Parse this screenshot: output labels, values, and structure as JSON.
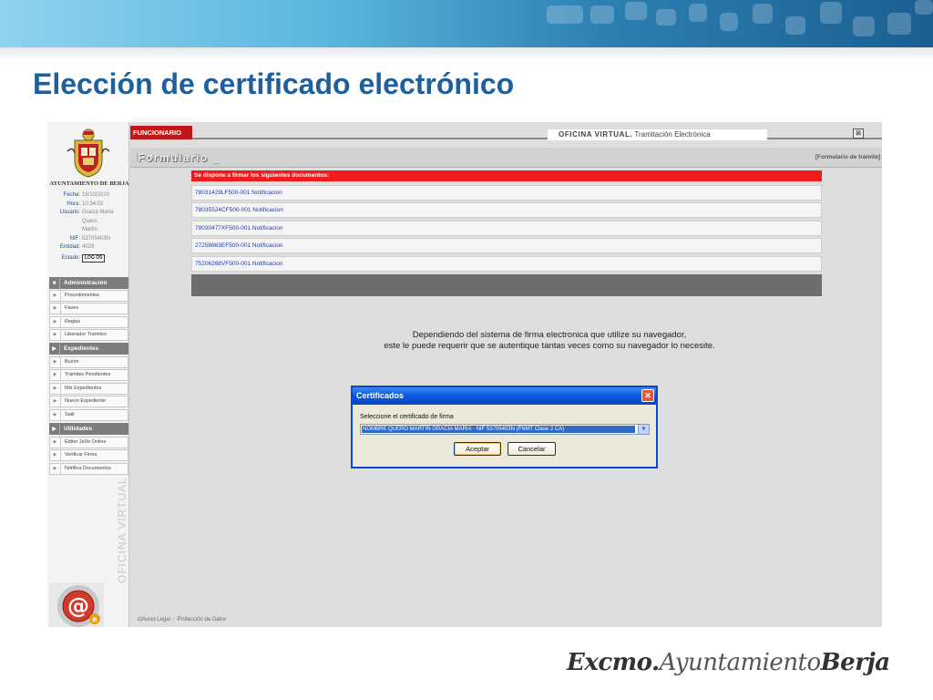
{
  "slide": {
    "title": "Elección de certificado electrónico",
    "footer_brand": {
      "part1": "Excmo.",
      "part2": "Ayuntamiento",
      "part3": "Berja"
    }
  },
  "sidebar": {
    "town_name": "AYUNTAMIENTO DE BERJA",
    "info": [
      {
        "label": "Fecha:",
        "value": "18/10/2010"
      },
      {
        "label": "Hora:",
        "value": "10:34:02"
      },
      {
        "label": "Usuario:",
        "value": "Gracia María"
      },
      {
        "label": "",
        "value": "Quero"
      },
      {
        "label": "",
        "value": "Martín"
      },
      {
        "label": "NIF:",
        "value": "53705403N"
      },
      {
        "label": "Entidad:",
        "value": "4029"
      }
    ],
    "status_label": "Estado:",
    "logout_label": "LOG OS",
    "sections": [
      {
        "title": "Administración",
        "items": [
          "Procedimientos",
          "Fases",
          "Reglas",
          "Liberador Tramites"
        ]
      },
      {
        "title": "Expedientes",
        "items": [
          "Buzón",
          "Trámites Pendientes",
          "Mis Expedientes",
          "Nuevo Expediente",
          "Salir"
        ]
      },
      {
        "title": "Utilidades",
        "items": [
          "Editor JaVe Online",
          "Verificar Firma",
          "Notifica Documentos"
        ]
      }
    ],
    "vertical_brand": "OFICINA VIRTUAL"
  },
  "topbar": {
    "role": "FUNCIONARIO",
    "office_bold": "OFICINA VIRTUAL.",
    "office_rest": " Tramitación Electrónica",
    "close_glyph": "⊠"
  },
  "form": {
    "heading": "Formulario _",
    "heading_link": "[Formulario de trámite]",
    "doc_header": "Se dispone a firmar los siguientes documentos:",
    "documents": [
      "78031429LF500-001 Notificacion",
      "78035524CF500-001 Notificacion",
      "78030477XF500-001 Notificacion",
      "27258863EF500-001 Notificacion",
      "75206268VF500-001 Notificacion"
    ],
    "notice_line1": "Dependiendo del sistema de firma electronica que utilize su navegador,",
    "notice_line2": "este le puede requerir que se autentique tantas veces como su navegador lo necesite."
  },
  "dialog": {
    "title": "Certificados",
    "label": "Seleccione el certificado de firma",
    "selected": "NOMBRE QUERO MARTIN GRACIA MARIA - NIF 53705403N (FNMT Clase 2 CA)",
    "ok": "Aceptar",
    "cancel": "Cancelar"
  },
  "footer": {
    "legal": "Aviso Legal",
    "privacy": "Protección de Datos"
  },
  "colors": {
    "title_blue": "#1f5f9c",
    "header_red": "#ee1c1c",
    "role_red": "#c01818",
    "xp_blue": "#0a5ae0"
  }
}
